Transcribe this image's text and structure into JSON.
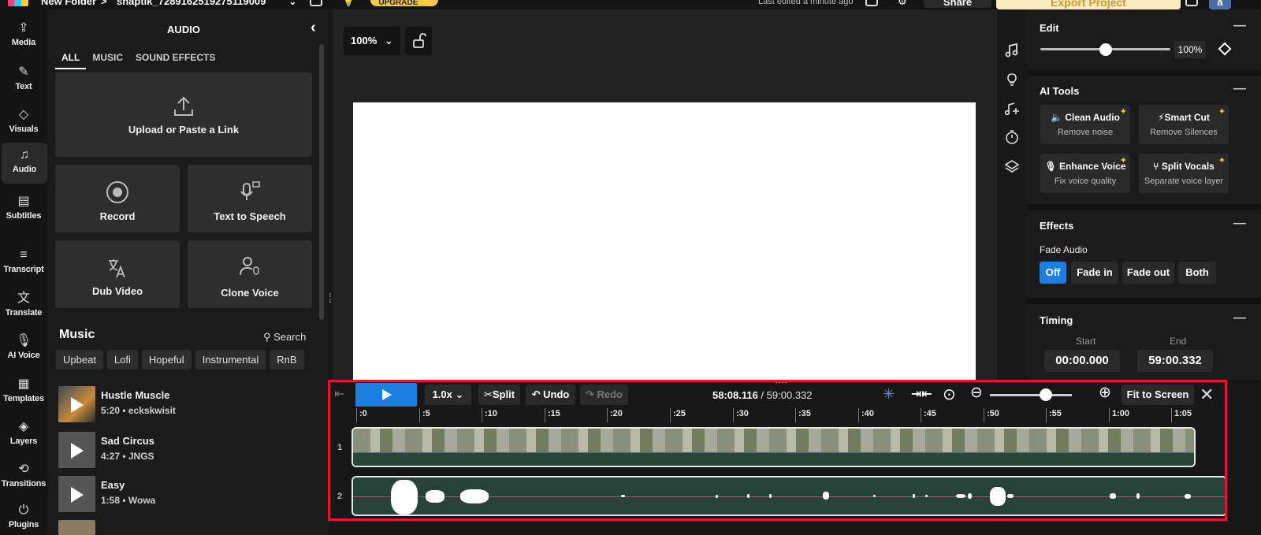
{
  "topbar": {
    "folder": "New Folder",
    "sep": ">",
    "project": "snaptik_7289162519275119009",
    "upgrade": "UPGRADE ✨",
    "last_edited": "Last edited a minute ago",
    "share": "Share",
    "export": "Export Project",
    "avatar": "a"
  },
  "nav": [
    {
      "label": "Media",
      "icon": "upload-cloud-icon",
      "glyph": "⇪"
    },
    {
      "label": "Text",
      "icon": "edit-text-icon",
      "glyph": "✎"
    },
    {
      "label": "Visuals",
      "icon": "shapes-icon",
      "glyph": "◇"
    },
    {
      "label": "Audio",
      "icon": "music-note-icon",
      "glyph": "♫"
    },
    {
      "label": "Subtitles",
      "icon": "subtitles-icon",
      "glyph": "▤"
    },
    {
      "label": "Transcript",
      "icon": "transcript-icon",
      "glyph": "≡"
    },
    {
      "label": "Translate",
      "icon": "translate-icon",
      "glyph": "文"
    },
    {
      "label": "AI Voice",
      "icon": "microphone-icon",
      "glyph": "🎙"
    },
    {
      "label": "Templates",
      "icon": "templates-icon",
      "glyph": "▦"
    },
    {
      "label": "Layers",
      "icon": "layers-icon",
      "glyph": "◈"
    },
    {
      "label": "Transitions",
      "icon": "transitions-icon",
      "glyph": "⟲"
    },
    {
      "label": "Plugins",
      "icon": "plug-icon",
      "glyph": "⏻"
    }
  ],
  "audio_panel": {
    "title": "AUDIO",
    "tabs": [
      "ALL",
      "MUSIC",
      "SOUND EFFECTS"
    ],
    "upload": "Upload or Paste a Link",
    "record": "Record",
    "tts": "Text to Speech",
    "dub": "Dub Video",
    "clone": "Clone Voice",
    "music_heading": "Music",
    "search": "Search",
    "genres": [
      "Upbeat",
      "Lofi",
      "Hopeful",
      "Instrumental",
      "RnB"
    ],
    "tracks": [
      {
        "name": "Hustle Muscle",
        "meta": "5:20 • eckskwisit"
      },
      {
        "name": "Sad Circus",
        "meta": "4:27 • JNGS"
      },
      {
        "name": "Easy",
        "meta": "1:58 • Wowa"
      }
    ]
  },
  "canvas": {
    "zoom": "100%"
  },
  "right": {
    "edit_title": "Edit",
    "edit_pct": "100%",
    "volume_level": 0.5,
    "ai_title": "AI Tools",
    "ai_tools": [
      {
        "name": "Clean Audio",
        "desc": "Remove noise"
      },
      {
        "name": "Smart Cut",
        "desc": "Remove Silences"
      },
      {
        "name": "Enhance Voice",
        "desc": "Fix voice quality"
      },
      {
        "name": "Split Vocals",
        "desc": "Separate voice layer"
      }
    ],
    "effects_title": "Effects",
    "fade_label": "Fade Audio",
    "fade_options": [
      "Off",
      "Fade in",
      "Fade out",
      "Both"
    ],
    "fade_selected": "Off",
    "timing_title": "Timing",
    "start_label": "Start",
    "end_label": "End",
    "start": "00:00.000",
    "end": "59:00.332"
  },
  "timeline": {
    "speed": "1.0x",
    "split": "Split",
    "undo": "Undo",
    "redo": "Redo",
    "current": "58:08.116",
    "total": " / 59:00.332",
    "fit": "Fit to Screen",
    "ticks": [
      ":0",
      ":5",
      ":10",
      ":15",
      ":20",
      ":25",
      ":30",
      ":35",
      ":40",
      ":45",
      ":50",
      ":55",
      "1:00",
      "1:05"
    ],
    "track1": "1",
    "track2": "2"
  },
  "colors": {
    "accent": "#1a7fe0",
    "highlight": "#e2172b",
    "upgrade": "#f6c84a"
  }
}
